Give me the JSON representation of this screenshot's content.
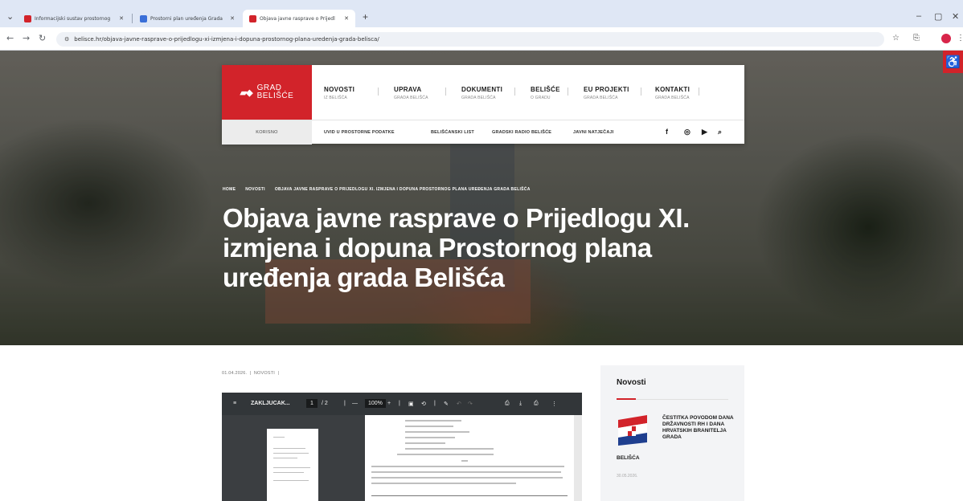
{
  "browser": {
    "tabs": [
      {
        "title": "Informacijski sustav prostornog",
        "favicon_color": "#d2232a"
      },
      {
        "title": "Prostorni plan uređenja Grada",
        "favicon_color": "#3a6fd8"
      },
      {
        "title": "Objava javne rasprave o Prijedl",
        "favicon_color": "#d2232a"
      }
    ],
    "new_tab": "+",
    "url": "belisce.hr/objava-javne-rasprave-o-prijedlogu-xi-izmjena-i-dopuna-prostornog-plana-uredenja-grada-belisca/",
    "back_icon": "arrow-left-icon",
    "forward_icon": "arrow-right-icon",
    "reload_icon": "reload-icon",
    "site_info_icon": "tune-icon"
  },
  "site": {
    "logo": {
      "line1": "GRAD",
      "line2": "BELIŠĆE"
    },
    "menu": [
      {
        "label": "NOVOSTI",
        "sub": "IZ BELIŠĆA"
      },
      {
        "label": "UPRAVA",
        "sub": "GRADA BELIŠĆA"
      },
      {
        "label": "DOKUMENTI",
        "sub": "GRADA BELIŠĆA"
      },
      {
        "label": "BELIŠĆE",
        "sub": "O GRADU"
      },
      {
        "label": "EU PROJEKTI",
        "sub": "GRADA BELIŠĆA"
      },
      {
        "label": "KONTAKTI",
        "sub": "GRADA BELIŠĆA"
      }
    ],
    "subnav": {
      "korisno": "KORISNO",
      "items": [
        "UVID U PROSTORNE PODATKE",
        "BELIŠĆANSKI LIST",
        "GRADSKI RADIO BELIŠĆE",
        "JAVNI NATJEČAJI"
      ]
    },
    "social_icons": [
      "facebook-icon",
      "instagram-icon",
      "youtube-icon",
      "search-icon"
    ]
  },
  "hero": {
    "breadcrumb": [
      "HOME",
      "NOVOSTI",
      "OBJAVA JAVNE RASPRAVE O PRIJEDLOGU XI. IZMJENA I DOPUNA PROSTORNOG PLANA UREĐENJA GRADA BELIŠĆA"
    ],
    "title": "Objava javne rasprave o Prijedlogu XI. izmjena i dopuna Prostornog plana uređenja grada Belišća"
  },
  "article": {
    "date": "01.04.2026.",
    "category": "NOVOSTI",
    "pdf": {
      "filename": "ZAKLJUCAK...",
      "page_current": "1",
      "page_total": "/ 2",
      "zoom": "100%"
    }
  },
  "sidebar": {
    "title": "Novosti",
    "news": [
      {
        "title": "ČESTITKA POVODOM DANA DRŽAVNOSTI RH I DANA HRVATSKIH BRANITELJA GRADA",
        "title_tail": "BELIŠĆA",
        "date": "30.05.2026."
      }
    ]
  },
  "colors": {
    "brand_red": "#d2232a"
  }
}
